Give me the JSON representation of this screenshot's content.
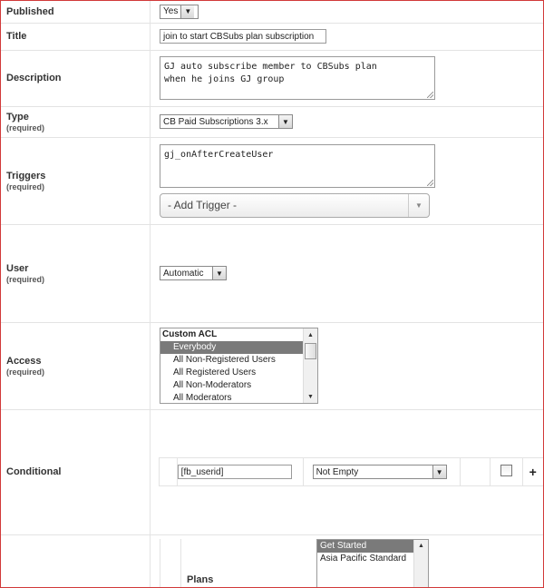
{
  "fields": {
    "published": {
      "label": "Published",
      "value": "Yes"
    },
    "title": {
      "label": "Title",
      "value": "join to start CBSubs plan subscription"
    },
    "description": {
      "label": "Description",
      "value": "GJ auto subscribe member to CBSubs plan\nwhen he joins GJ group"
    },
    "type": {
      "label": "Type",
      "required": "(required)",
      "value": "CB Paid Subscriptions 3.x"
    },
    "triggers": {
      "label": "Triggers",
      "required": "(required)",
      "value": "gj_onAfterCreateUser",
      "add_placeholder": "- Add Trigger -"
    },
    "user": {
      "label": "User",
      "required": "(required)",
      "value": "Automatic"
    },
    "access": {
      "label": "Access",
      "required": "(required)",
      "group": "Custom ACL",
      "options": [
        "Everybody",
        "All Non-Registered Users",
        "All Registered Users",
        "All Non-Moderators",
        "All Moderators"
      ],
      "selected": "Everybody"
    },
    "conditional": {
      "label": "Conditional",
      "field_value": "[fb_userid]",
      "operator": "Not Empty",
      "add_symbol": "+"
    },
    "plans": {
      "label": "Plans",
      "options": [
        "Get Started",
        "Asia Pacific Standard"
      ],
      "selected": "Get Started"
    }
  }
}
